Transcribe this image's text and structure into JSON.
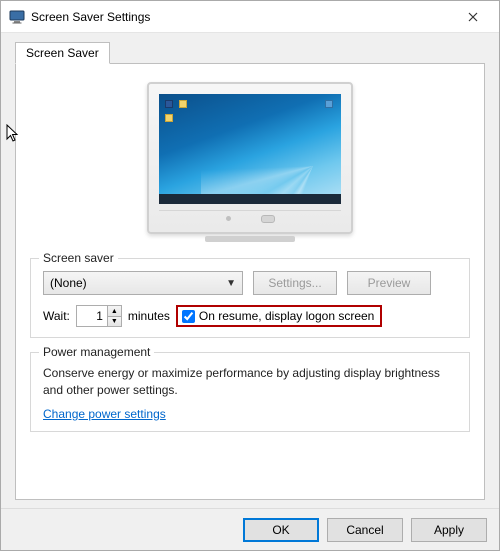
{
  "title": "Screen Saver Settings",
  "tab_label": "Screen Saver",
  "group_screensaver": {
    "legend": "Screen saver",
    "selected": "(None)",
    "settings_btn": "Settings...",
    "preview_btn": "Preview",
    "wait_label": "Wait:",
    "wait_value": "1",
    "wait_units": "minutes",
    "on_resume_checked": true,
    "on_resume_label": "On resume, display logon screen"
  },
  "group_power": {
    "legend": "Power management",
    "text": "Conserve energy or maximize performance by adjusting display brightness and other power settings.",
    "link": "Change power settings"
  },
  "buttons": {
    "ok": "OK",
    "cancel": "Cancel",
    "apply": "Apply"
  }
}
